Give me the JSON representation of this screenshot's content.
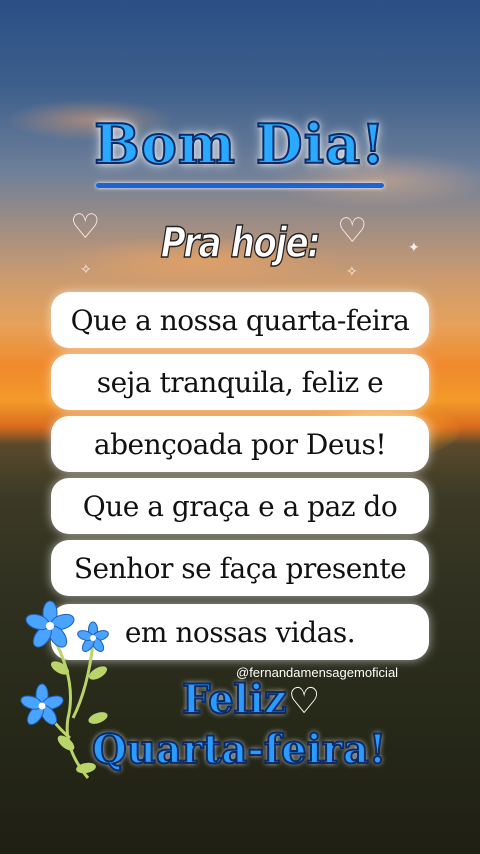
{
  "title": "Bom Dia!",
  "subtitle": "Pra hoje:",
  "lines": [
    "Que a nossa quarta-feira",
    "seja tranquila, feliz e",
    "abençoada por Deus!",
    "Que a graça e a paz do",
    "Senhor se faça presente",
    "em nossas vidas."
  ],
  "handle": "@fernandamensagemoficial",
  "closing": {
    "line1": "Feliz",
    "line2": "Quarta-feira!"
  },
  "colors": {
    "title_fill": "#29a9ff",
    "title_outline": "#0b2a66",
    "pill_bg": "#ffffff",
    "flower": "#4aa3ff"
  },
  "icons": [
    "heart-icon",
    "flower-icon",
    "sparkle-icon"
  ]
}
